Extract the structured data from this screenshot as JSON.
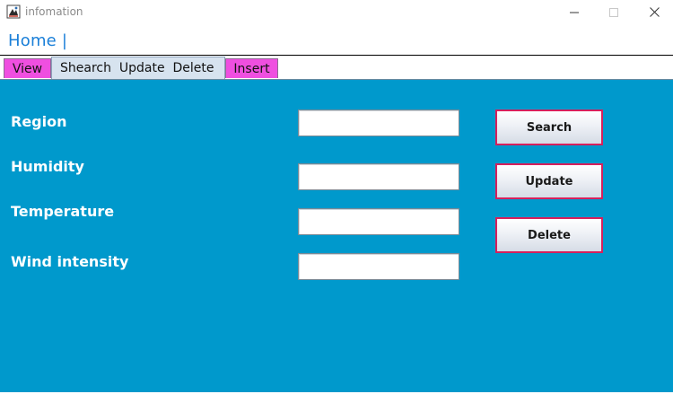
{
  "window": {
    "title": "infomation",
    "icon": "java-app-icon",
    "controls": [
      "minimize-icon",
      "maximize-icon",
      "close-icon"
    ]
  },
  "menubar": {
    "home_label": "Home |"
  },
  "tabs": {
    "view": "View",
    "active": "Shearch  Update  Delete",
    "insert": "Insert"
  },
  "form": {
    "region_label": "Region",
    "humidity_label": "Humidity",
    "temperature_label": "Temperature",
    "wind_label": "Wind intensity",
    "region_value": "",
    "humidity_value": "",
    "temperature_value": "",
    "wind_value": ""
  },
  "actions": {
    "search_label": "Search",
    "update_label": "Update",
    "delete_label": "Delete"
  },
  "colors": {
    "panel_background": "#0099cc",
    "tab_pink": "#ef4fe0",
    "tab_active": "#d7e3ef",
    "menu_text": "#1a7fd8",
    "button_border": "#d6205c"
  }
}
